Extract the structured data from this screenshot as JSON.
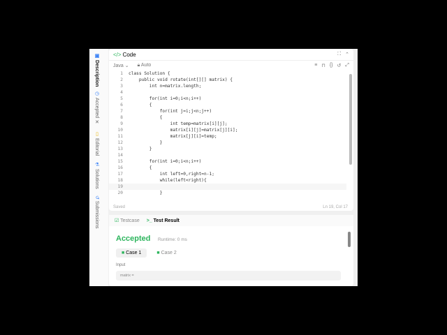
{
  "sidebar": {
    "tabs": [
      {
        "label": "Description"
      },
      {
        "label": "Accepted"
      },
      {
        "label": "Editorial"
      },
      {
        "label": "Solutions"
      },
      {
        "label": "Submissions"
      }
    ]
  },
  "code_panel": {
    "title": "Code",
    "language": "Java",
    "mode": "Auto",
    "status": "Saved",
    "cursor": "Ln 19, Col 17",
    "lines": [
      "class Solution {",
      "    public void rotate(int[][] matrix) {",
      "        int n=matrix.length;",
      "",
      "        for(int i=0;i<n;i++)",
      "        {",
      "            for(int j=i;j<n;j++)",
      "            {",
      "                int temp=matrix[i][j];",
      "                matrix[i][j]=matrix[j][i];",
      "                matrix[j][i]=temp;",
      "            }",
      "        }",
      "",
      "        for(int i=0;i<n;i++)",
      "        {",
      "            int left=0,right=n-1;",
      "            while(left<right){",
      "                ",
      "            }"
    ]
  },
  "result_panel": {
    "tabs": [
      "Testcase",
      "Test Result"
    ],
    "verdict": "Accepted",
    "runtime": "Runtime: 0 ms",
    "cases": [
      "Case 1",
      "Case 2"
    ],
    "input_label": "Input",
    "input_value": "matrix ="
  },
  "colors": {
    "accent": "#2db55d"
  }
}
